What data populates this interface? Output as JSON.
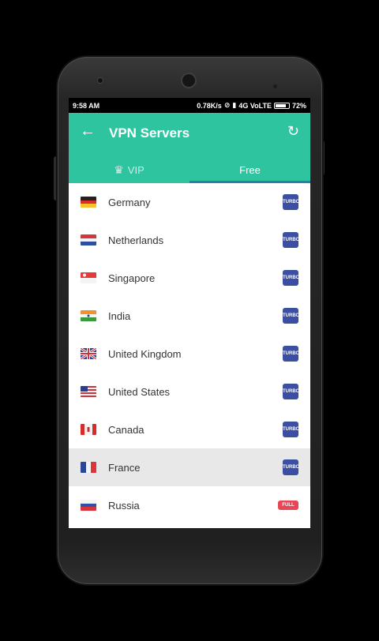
{
  "status_bar": {
    "time": "9:58 AM",
    "speed": "0.78K/s",
    "network": "4G VoLTE",
    "battery": "72%"
  },
  "app_bar": {
    "title": "VPN Servers",
    "back_icon": "arrow-left-icon",
    "refresh_icon": "refresh-icon"
  },
  "tabs": [
    {
      "label": "VIP",
      "icon": "crown-icon",
      "active": false
    },
    {
      "label": "Free",
      "active": true
    }
  ],
  "servers": [
    {
      "country": "Germany",
      "badge": "TURBO",
      "flag": "de"
    },
    {
      "country": "Netherlands",
      "badge": "TURBO",
      "flag": "nl"
    },
    {
      "country": "Singapore",
      "badge": "TURBO",
      "flag": "sg"
    },
    {
      "country": "India",
      "badge": "TURBO",
      "flag": "in"
    },
    {
      "country": "United Kingdom",
      "badge": "TURBO",
      "flag": "gb"
    },
    {
      "country": "United States",
      "badge": "TURBO",
      "flag": "us"
    },
    {
      "country": "Canada",
      "badge": "TURBO",
      "flag": "ca"
    },
    {
      "country": "France",
      "badge": "TURBO",
      "flag": "fr",
      "selected": true
    },
    {
      "country": "Russia",
      "badge": "FULL",
      "flag": "ru"
    }
  ],
  "colors": {
    "accent": "#2fc4a0",
    "turbo": "#3b4ea2",
    "full": "#e94655",
    "tab_indicator": "#2a7ea8"
  }
}
